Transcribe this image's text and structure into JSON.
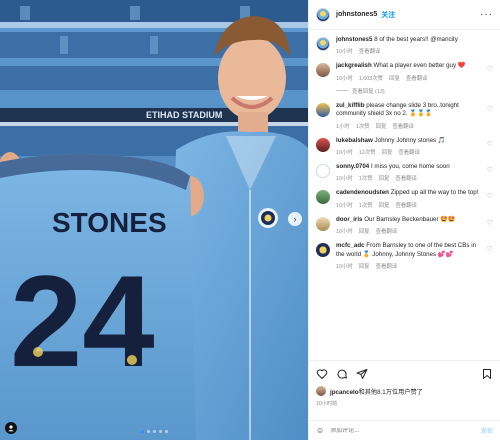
{
  "post_image": {
    "stadium_sign": "ETIHAD STADIUM",
    "shirt_name": "STONES",
    "shirt_number": "24",
    "carousel_total": 5,
    "carousel_active": 1
  },
  "header": {
    "username": "johnstones5",
    "follow_label": "关注",
    "more_icon": "more-horizontal-icon"
  },
  "caption": {
    "username": "johnstones5",
    "text": "8 of the best years!! @mancity",
    "time": "10小时",
    "translate": "查看翻译"
  },
  "comments": [
    {
      "username": "jackgrealish",
      "text": "What a player even better guy ❤️",
      "time": "10小时",
      "likes": "1,603次赞",
      "reply": "回复",
      "translate": "查看翻译",
      "replies_label": "查看回复 (13)"
    },
    {
      "username": "zul_kifflib",
      "text": "please change slide 3 bro..tonight community shield 3x no 2. 🏅🏅🏅",
      "time": "1小时",
      "likes": "1次赞",
      "reply": "回复",
      "translate": "查看翻译"
    },
    {
      "username": "lukebalshaw",
      "text": "Johnny Johnny stones 🎵",
      "time": "10小时",
      "likes": "12次赞",
      "reply": "回复",
      "translate": "查看翻译"
    },
    {
      "username": "sonny.0704",
      "text": "I miss you, come home soon",
      "time": "10小时",
      "likes": "1次赞",
      "reply": "回复",
      "translate": "查看翻译"
    },
    {
      "username": "cadendenoudsten",
      "text": "Zipped up all the way to the top!",
      "time": "10小时",
      "likes": "1次赞",
      "reply": "回复",
      "translate": "查看翻译"
    },
    {
      "username": "door_iris",
      "text": "Our Barnsley Beckenbauer 🤩🤩",
      "time": "10小时",
      "likes": "",
      "reply": "回复",
      "translate": "查看翻译"
    },
    {
      "username": "mcfc_adc",
      "text": "From Barnsley to one of the best CBs in the world 🏅 Johnny, Johnny Stones 💕💕",
      "time": "10小时",
      "likes": "",
      "reply": "回复",
      "translate": "查看翻译"
    }
  ],
  "footer": {
    "likes_text_user": "jpcancelo",
    "likes_text_rest": "和其他8.1万位用户赞了",
    "time": "10小时前",
    "add_comment_placeholder": "添加评论...",
    "post_label": "发布"
  },
  "colors": {
    "accent": "#0095f6",
    "city_blue": "#6cabdd",
    "navy": "#1c2c5b"
  }
}
